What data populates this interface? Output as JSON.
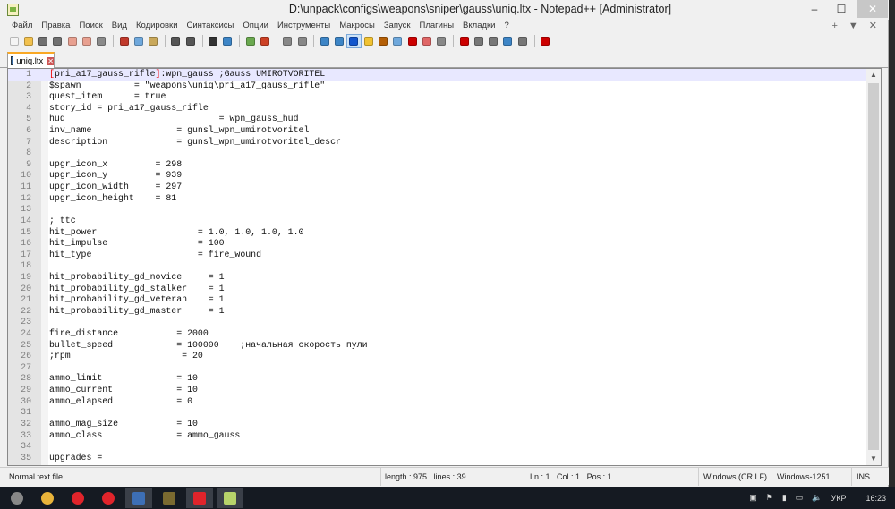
{
  "window": {
    "title": "D:\\unpack\\configs\\weapons\\sniper\\gauss\\uniq.ltx - Notepad++ [Administrator]",
    "minimize": "–",
    "maximize": "☐",
    "close": "✕"
  },
  "menu": [
    "Файл",
    "Правка",
    "Поиск",
    "Вид",
    "Кодировки",
    "Синтаксисы",
    "Опции",
    "Инструменты",
    "Макросы",
    "Запуск",
    "Плагины",
    "Вкладки",
    "?"
  ],
  "menu_right": {
    "add": "+",
    "dropdown": "▼",
    "close": "✕"
  },
  "toolbar": [
    {
      "icon": "new-file-icon",
      "color": "#f4f4f4"
    },
    {
      "icon": "open-file-icon",
      "color": "#f2c14e"
    },
    {
      "icon": "save-icon",
      "color": "#707070"
    },
    {
      "icon": "save-all-icon",
      "color": "#707070"
    },
    {
      "icon": "close-icon",
      "color": "#e8a090"
    },
    {
      "icon": "close-all-icon",
      "color": "#e8a090"
    },
    {
      "icon": "print-icon",
      "color": "#8a8a8a"
    },
    {
      "sep": true
    },
    {
      "icon": "cut-icon",
      "color": "#c0392b"
    },
    {
      "icon": "copy-icon",
      "color": "#6fa8dc"
    },
    {
      "icon": "paste-icon",
      "color": "#c9a85a"
    },
    {
      "sep": true
    },
    {
      "icon": "undo-icon",
      "color": "#555"
    },
    {
      "icon": "redo-icon",
      "color": "#555"
    },
    {
      "sep": true
    },
    {
      "icon": "find-icon",
      "color": "#333"
    },
    {
      "icon": "replace-icon",
      "color": "#3d85c6"
    },
    {
      "sep": true
    },
    {
      "icon": "zoom-in-icon",
      "color": "#6aa84f"
    },
    {
      "icon": "zoom-out-icon",
      "color": "#cc4125"
    },
    {
      "sep": true
    },
    {
      "icon": "sync-vertical-icon",
      "color": "#888"
    },
    {
      "icon": "sync-horizontal-icon",
      "color": "#888"
    },
    {
      "sep": true
    },
    {
      "icon": "word-wrap-icon",
      "color": "#3d85c6"
    },
    {
      "icon": "show-all-chars-icon",
      "color": "#3d85c6"
    },
    {
      "icon": "indent-guide-icon",
      "color": "#1155cc"
    },
    {
      "icon": "udl-icon",
      "color": "#f1c232"
    },
    {
      "icon": "doc-map-icon",
      "color": "#b45f06"
    },
    {
      "icon": "doc-list-icon",
      "color": "#6fa8dc"
    },
    {
      "icon": "function-list-icon",
      "color": "#cc0000"
    },
    {
      "icon": "folder-workspace-icon",
      "color": "#e06666"
    },
    {
      "icon": "monitoring-icon",
      "color": "#888"
    },
    {
      "sep": true
    },
    {
      "icon": "record-macro-icon",
      "color": "#cc0000"
    },
    {
      "icon": "stop-macro-icon",
      "color": "#777"
    },
    {
      "icon": "play-macro-icon",
      "color": "#777"
    },
    {
      "icon": "run-macro-multiple-icon",
      "color": "#3d85c6"
    },
    {
      "icon": "save-macro-icon",
      "color": "#777"
    },
    {
      "sep": true
    },
    {
      "icon": "spell-check-icon",
      "color": "#cc0000"
    }
  ],
  "tab": {
    "label": "uniq.ltx",
    "close": "✕"
  },
  "lines": [
    "[pri_a17_gauss_rifle]:wpn_gauss ;Gauss UMIROTVORITEL",
    "$spawn          = \"weapons\\uniq\\pri_a17_gauss_rifle\"",
    "quest_item      = true",
    "story_id = pri_a17_gauss_rifle",
    "hud                             = wpn_gauss_hud",
    "inv_name                = gunsl_wpn_umirotvoritel",
    "description             = gunsl_wpn_umirotvoritel_descr",
    "",
    "upgr_icon_x         = 298",
    "upgr_icon_y         = 939",
    "upgr_icon_width     = 297",
    "upgr_icon_height    = 81",
    "",
    "; ttc",
    "hit_power                   = 1.0, 1.0, 1.0, 1.0",
    "hit_impulse                 = 100",
    "hit_type                    = fire_wound",
    "",
    "hit_probability_gd_novice     = 1",
    "hit_probability_gd_stalker    = 1",
    "hit_probability_gd_veteran    = 1",
    "hit_probability_gd_master     = 1",
    "",
    "fire_distance           = 2000",
    "bullet_speed            = 100000    ;начальная скорость пули",
    ";rpm                     = 20",
    "",
    "ammo_limit              = 10",
    "ammo_current            = 10",
    "ammo_elapsed            = 0",
    "",
    "ammo_mag_size           = 10",
    "ammo_class              = ammo_gauss",
    "",
    "upgrades ="
  ],
  "status": {
    "type": "Normal text file",
    "length": "length : 975",
    "lines": "lines : 39",
    "ln": "Ln : 1",
    "col": "Col : 1",
    "pos": "Pos : 1",
    "eol": "Windows (CR LF)",
    "encoding": "Windows-1251",
    "mode": "INS"
  },
  "taskbar": {
    "apps": [
      {
        "icon": "start-icon",
        "color": "#888"
      },
      {
        "icon": "chrome-icon",
        "color": "#e8b33a"
      },
      {
        "icon": "opera-icon",
        "color": "#e0242b"
      },
      {
        "icon": "yandex-browser-icon",
        "color": "#e0242b"
      },
      {
        "icon": "floppy-app-icon",
        "color": "#3d6fb6"
      },
      {
        "icon": "stalker-game-icon",
        "color": "#7a6a30"
      },
      {
        "icon": "opera-icon",
        "color": "#e0242b"
      },
      {
        "icon": "notepadpp-icon",
        "color": "#b7d36a"
      }
    ],
    "language": "УКР",
    "time": "16:23"
  }
}
